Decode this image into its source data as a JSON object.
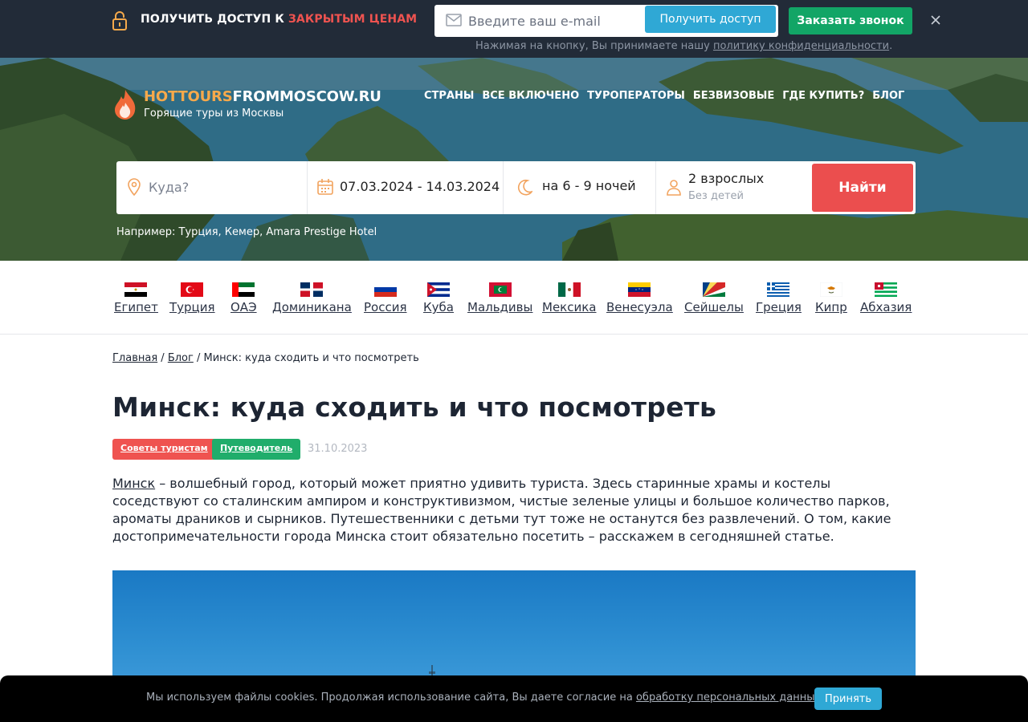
{
  "topbar": {
    "promo_prefix": "ПОЛУЧИТЬ ДОСТУП К ",
    "promo_accent": "ЗАКРЫТЫМ ЦЕНАМ",
    "email_placeholder": "Введите ваш e-mail",
    "email_value": "",
    "access_button": "Получить доступ",
    "call_button": "Заказать звонок",
    "consent_prefix": "Нажимая на кнопку, Вы принимаете нашу ",
    "consent_link": "политику конфиденциальности",
    "consent_suffix": "."
  },
  "logo": {
    "title_hot": "HOTTOURS",
    "title_rest": "FROMMOSCOW.RU",
    "subtitle": "Горящие туры из Москвы"
  },
  "nav": [
    {
      "label": "СТРАНЫ"
    },
    {
      "label": "ВСЕ ВКЛЮЧЕНО"
    },
    {
      "label": "ТУРОПЕРАТОРЫ"
    },
    {
      "label": "БЕЗВИЗОВЫЕ"
    },
    {
      "label": "ГДЕ КУПИТЬ?"
    },
    {
      "label": "БЛОГ"
    }
  ],
  "search": {
    "where_placeholder": "Куда?",
    "where_value": "",
    "dates": "07.03.2024 - 14.03.2024",
    "nights": "на 6 - 9 ночей",
    "adults": "2 взрослых",
    "children": "Без детей",
    "find_button": "Найти",
    "example": "Например: Турция, Кемер, Amara Prestige Hotel"
  },
  "countries": [
    {
      "name": "Египет",
      "flag": "egypt-flag"
    },
    {
      "name": "Турция",
      "flag": "turkey-flag"
    },
    {
      "name": "ОАЭ",
      "flag": "uae-flag"
    },
    {
      "name": "Доминикана",
      "flag": "dominican-flag"
    },
    {
      "name": "Россия",
      "flag": "russia-flag"
    },
    {
      "name": "Куба",
      "flag": "cuba-flag"
    },
    {
      "name": "Мальдивы",
      "flag": "maldives-flag"
    },
    {
      "name": "Мексика",
      "flag": "mexico-flag"
    },
    {
      "name": "Венесуэла",
      "flag": "venezuela-flag"
    },
    {
      "name": "Сейшелы",
      "flag": "seychelles-flag"
    },
    {
      "name": "Греция",
      "flag": "greece-flag"
    },
    {
      "name": "Кипр",
      "flag": "cyprus-flag"
    },
    {
      "name": "Абхазия",
      "flag": "abkhazia-flag"
    }
  ],
  "breadcrumb": {
    "home": "Главная",
    "sep": " / ",
    "blog": "Блог",
    "current": "Минск: куда сходить и что посмотреть"
  },
  "article": {
    "title": "Минск: куда сходить и что посмотреть",
    "tags": [
      "Советы туристам",
      "Путеводитель"
    ],
    "date": "31.10.2023",
    "lead_link": "Минск",
    "lead_text": " – волшебный город, который может приятно удивить туриста. Здесь старинные храмы и костелы соседствуют со сталинским ампиром и конструктивизмом, чистые зеленые улицы и большое количество парков, ароматы драников и сырников. Путешественники с детьми тут тоже не останутся без развлечений. О том, какие достопримечательности города Минска стоит обязательно посетить – расскажем в сегодняшней статье."
  },
  "cookie": {
    "text": "Мы используем файлы cookies. Продолжая использование сайта, Вы даете согласие на ",
    "link": "обработку персональных данных",
    "suffix": ".",
    "accept": "Принять"
  },
  "colors": {
    "topbar_bg": "#222b38",
    "accent_red": "#ef5350",
    "access_blue": "#2fa8d5",
    "call_green": "#12a566",
    "find_red": "#eb4e4e",
    "logo_orange": "#f6a94b"
  }
}
